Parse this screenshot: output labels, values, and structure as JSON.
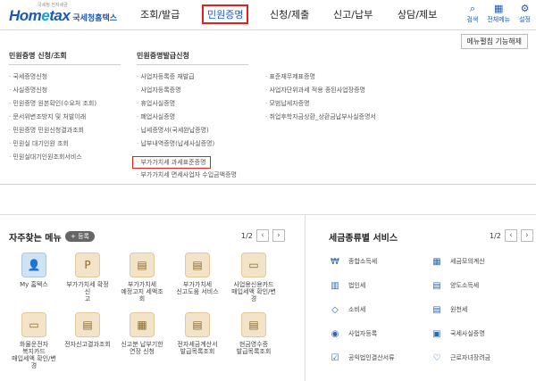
{
  "header": {
    "logo_text_a": "Hom",
    "logo_text_o": "e",
    "logo_text_b": "tax",
    "logo_sub": "국세청홈택스",
    "logo_tiny": "국세청 전자세금",
    "nav": [
      "조회/발급",
      "민원증명",
      "신청/제출",
      "신고/납부",
      "상담/제보"
    ],
    "tools": [
      {
        "icon": "search-icon",
        "glyph": "⌕",
        "label": "검색"
      },
      {
        "icon": "grid-icon",
        "glyph": "▦",
        "label": "전체메뉴"
      },
      {
        "icon": "gear-icon",
        "glyph": "⚙",
        "label": "설정"
      }
    ]
  },
  "mega": {
    "close_label": "메뉴펼침 기능해제",
    "col1": {
      "title": "민원증명 신청/조회",
      "items": [
        "국세증명신청",
        "사실증명신청",
        "민원증명 원본확인(수요처 조회)",
        "문서위변조방지 및 처발이래",
        "민원증명 민원신청결과조회",
        "민원실 대기인원 조회",
        "민원실대기인원조회서비스"
      ]
    },
    "col2": {
      "title": "민원증명발급신청",
      "items": [
        "사업자등록증 재발급",
        "사업자등록증명",
        "휴업사실증명",
        "폐업사실증명",
        "납세증명서(국세완납증명)",
        "납부내역증명(납세사실증명)",
        "부가가치세 과세표준증명",
        "부가가치세 면세사업자 수입금액증명"
      ]
    },
    "col3": {
      "items": [
        "표준재무제표증명",
        "사업자단위과세 적용 종된사업장증명",
        "모범납세자증명",
        "취업후학자금상환_상환금납부사실증명서"
      ]
    }
  },
  "favorites": {
    "title": "자주찾는 메뉴",
    "badge": "+ 등록",
    "page": "1/2",
    "items": [
      {
        "label": "My 홈택스",
        "icon": "user-icon",
        "glyph": "👤"
      },
      {
        "label": "부가가치세 확정신\n고",
        "icon": "document-icon",
        "glyph": "P"
      },
      {
        "label": "부가가치세\n예정고지 세액조회",
        "icon": "calculator-icon",
        "glyph": "▤"
      },
      {
        "label": "부가가치세\n신고도움 서비스",
        "icon": "document-icon",
        "glyph": "▤"
      },
      {
        "label": "사업용신용카드\n매입세액 확인/변경",
        "icon": "card-icon",
        "glyph": "▭"
      },
      {
        "label": "화물운전자\n복지카드\n매입세액 확인/변경",
        "icon": "card-icon",
        "glyph": "▭"
      },
      {
        "label": "전자신고결과조회",
        "icon": "document-icon",
        "glyph": "▤"
      },
      {
        "label": "신고분 납부기한\n연장 신청",
        "icon": "calendar-icon",
        "glyph": "▦"
      },
      {
        "label": "전자세금계산서\n발급목록조회",
        "icon": "invoice-icon",
        "glyph": "▤"
      },
      {
        "label": "현금영수증\n발급목록조회",
        "icon": "invoice-icon",
        "glyph": "▤"
      }
    ]
  },
  "taxes": {
    "title": "세금종류별 서비스",
    "page": "1/2",
    "items": [
      {
        "label": "종합소득세",
        "icon": "coins-icon",
        "glyph": "₩"
      },
      {
        "label": "세금모의계산",
        "icon": "calculator-icon",
        "glyph": "▦"
      },
      {
        "label": "법인세",
        "icon": "building-icon",
        "glyph": "▥"
      },
      {
        "label": "양도소득세",
        "icon": "document-icon",
        "glyph": "▤"
      },
      {
        "label": "소비세",
        "icon": "diamond-icon",
        "glyph": "◇"
      },
      {
        "label": "원천세",
        "icon": "document-icon",
        "glyph": "▤"
      },
      {
        "label": "사업자등록",
        "icon": "person-icon",
        "glyph": "◉"
      },
      {
        "label": "국세사실증명",
        "icon": "certificate-icon",
        "glyph": "▣"
      },
      {
        "label": "공익법인결산서류",
        "icon": "check-doc-icon",
        "glyph": "☑"
      },
      {
        "label": "근로자녀장려금",
        "icon": "heart-icon",
        "glyph": "♡"
      }
    ]
  }
}
